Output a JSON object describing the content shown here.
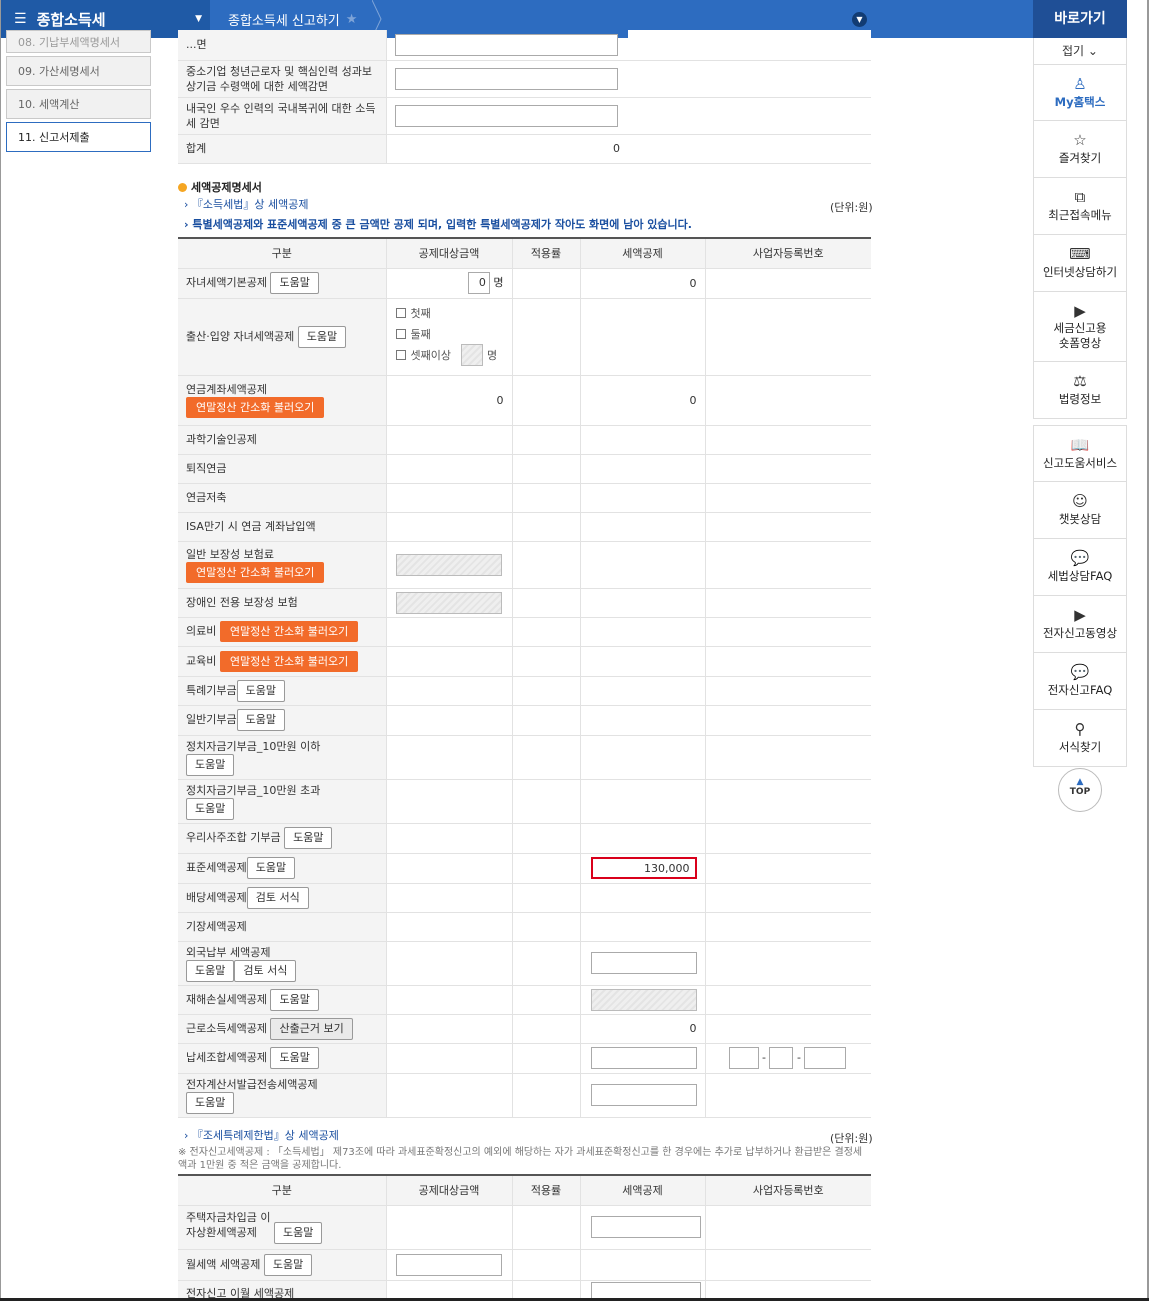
{
  "topbar": {
    "menu_label": "종합소득세",
    "breadcrumb": "종합소득세 신고하기"
  },
  "steps": [
    {
      "label": "08. 기납부세액명세서"
    },
    {
      "label": "09. 가산세명세서"
    },
    {
      "label": "10. 세액계산"
    },
    {
      "label": "11. 신고서제출"
    }
  ],
  "quick": {
    "title": "바로가기",
    "fold": "접기",
    "items": [
      {
        "label": "My홈택스",
        "icon": "person-icon"
      },
      {
        "label": "즐겨찾기",
        "icon": "star-icon"
      },
      {
        "label": "최근접속메뉴",
        "icon": "recent-icon"
      },
      {
        "label": "인터넷상담하기",
        "icon": "laptop-icon"
      },
      {
        "label": "세금신고용 숏폼영상",
        "icon": "play-icon"
      },
      {
        "label": "법령정보",
        "icon": "gavel-icon"
      },
      {
        "label": "신고도움서비스",
        "icon": "book-icon"
      },
      {
        "label": "챗봇상담",
        "icon": "chatbot-icon"
      },
      {
        "label": "세법상담FAQ",
        "icon": "chat-icon"
      },
      {
        "label": "전자신고동영상",
        "icon": "play-icon"
      },
      {
        "label": "전자신고FAQ",
        "icon": "chat-icon"
      },
      {
        "label": "서식찾기",
        "icon": "search-icon"
      }
    ],
    "top_label": "TOP"
  },
  "upper_table": {
    "rows": [
      {
        "label": "...면"
      },
      {
        "label": "중소기업 청년근로자 및 핵심인력 성과보상기금 수령액에 대한 세액감면"
      },
      {
        "label": "내국인 우수 인력의 국내복귀에 대한 소득세 감면"
      }
    ],
    "total_label": "합계",
    "total_value": "0"
  },
  "section": {
    "title": "세액공제명세서",
    "link1": "『소득세법』상 세액공제",
    "unit": "(단위:원)",
    "note": "특별세액공제와 표준세액공제 중 큰 금액만 공제 되며, 입력한 특별세액공제가 작아도 화면에 남아 있습니다."
  },
  "columns": [
    "구분",
    "공제대상금액",
    "적용률",
    "세액공제",
    "사업자등록번호"
  ],
  "buttons": {
    "help": "도움말",
    "review": "검토 서식",
    "calc_basis": "산출근거 보기",
    "import_simple": "연말정산 간소화 불러오기"
  },
  "rows": {
    "child_basic": {
      "label": "자녀세액기본공제",
      "count": "0",
      "unit": "명",
      "credit": "0"
    },
    "birth_adopt": {
      "label": "출산·입양 자녀세액공제",
      "opt1": "첫째",
      "opt2": "둘째",
      "opt3": "셋째이상",
      "unit": "명"
    },
    "pension": {
      "label": "연금계좌세액공제",
      "amount": "0",
      "credit": "0"
    },
    "science": {
      "label": "과학기술인공제"
    },
    "retire": {
      "label": "퇴직연금"
    },
    "pension_saving": {
      "label": "연금저축"
    },
    "isa": {
      "label": "ISA만기 시 연금 계좌납입액"
    },
    "insurance": {
      "label": "일반 보장성 보험료"
    },
    "disabled_ins": {
      "label": "장애인 전용 보장성 보험"
    },
    "medical": {
      "label": "의료비"
    },
    "education": {
      "label": "교육비"
    },
    "special_donation": {
      "label": "특례기부금"
    },
    "general_donation": {
      "label": "일반기부금"
    },
    "political_under": {
      "label": "정치자금기부금_10만원 이하"
    },
    "political_over": {
      "label": "정치자금기부금_10만원 초과"
    },
    "esop_donation": {
      "label": "우리사주조합 기부금"
    },
    "standard": {
      "label": "표준세액공제",
      "credit": "130,000"
    },
    "dividend": {
      "label": "배당세액공제"
    },
    "bookkeeping": {
      "label": "기장세액공제"
    },
    "foreign_tax": {
      "label": "외국납부 세액공제"
    },
    "disaster": {
      "label": "재해손실세액공제"
    },
    "earned_income": {
      "label": "근로소득세액공제",
      "credit": "0"
    },
    "tax_union": {
      "label": "납세조합세액공제",
      "sep": "-"
    },
    "e_invoice": {
      "label": "전자계산서발급전송세액공제"
    }
  },
  "section2": {
    "link": "『조세특례제한법』상 세액공제",
    "unit": "(단위:원)",
    "note": "※ 전자신고세액공제 : 「소득세법」 제73조에 따라 과세표준확정신고의 예외에 해당하는 자가 과세표준확정신고를 한 경우에는 추가로 납부하거나 환급받은 결정세액과 1만원 중 적은 금액을 공제합니다.",
    "rows": [
      {
        "label": "주택자금차입금 이자상환세액공제"
      },
      {
        "label": "월세액 세액공제"
      },
      {
        "label": "전자신고 이월 세액공제"
      }
    ]
  }
}
